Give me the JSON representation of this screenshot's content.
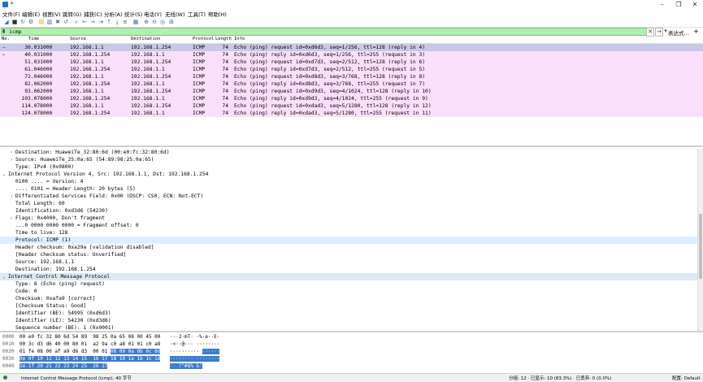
{
  "window": {
    "title": "*"
  },
  "menu": [
    "文件(F)",
    "编辑(E)",
    "视图(V)",
    "跳转(G)",
    "捕获(C)",
    "分析(A)",
    "统计(S)",
    "电话(Y)",
    "无线(W)",
    "工具(T)",
    "帮助(H)"
  ],
  "filter": {
    "value": "icmp",
    "expression_label": "表达式…",
    "plus": "+"
  },
  "columns": [
    "No.",
    "Time",
    "Source",
    "Destination",
    "Protocol",
    "Length",
    "Info"
  ],
  "packets": [
    {
      "no": "3",
      "time": "0.031000",
      "src": "192.168.1.1",
      "dst": "192.168.1.254",
      "proto": "ICMP",
      "len": "74",
      "info": "Echo (ping) request  id=0xd6d3, seq=1/256, ttl=128 (reply in 4)"
    },
    {
      "no": "4",
      "time": "0.031000",
      "src": "192.168.1.254",
      "dst": "192.168.1.1",
      "proto": "ICMP",
      "len": "74",
      "info": "Echo (ping) reply    id=0xd6d3, seq=1/256, ttl=255 (request in 3)"
    },
    {
      "no": "5",
      "time": "1.031000",
      "src": "192.168.1.1",
      "dst": "192.168.1.254",
      "proto": "ICMP",
      "len": "74",
      "info": "Echo (ping) request  id=0xd7d3, seq=2/512, ttl=128 (reply in 6)"
    },
    {
      "no": "6",
      "time": "1.046000",
      "src": "192.168.1.254",
      "dst": "192.168.1.1",
      "proto": "ICMP",
      "len": "74",
      "info": "Echo (ping) reply    id=0xd7d3, seq=2/512, ttl=255 (request in 5)"
    },
    {
      "no": "7",
      "time": "2.046000",
      "src": "192.168.1.1",
      "dst": "192.168.1.254",
      "proto": "ICMP",
      "len": "74",
      "info": "Echo (ping) request  id=0xd8d3, seq=3/768, ttl=128 (reply in 8)"
    },
    {
      "no": "8",
      "time": "2.062000",
      "src": "192.168.1.254",
      "dst": "192.168.1.1",
      "proto": "ICMP",
      "len": "74",
      "info": "Echo (ping) reply    id=0xd8d3, seq=3/768, ttl=255 (request in 7)"
    },
    {
      "no": "9",
      "time": "3.062000",
      "src": "192.168.1.1",
      "dst": "192.168.1.254",
      "proto": "ICMP",
      "len": "74",
      "info": "Echo (ping) request  id=0xd9d3, seq=4/1024, ttl=128 (reply in 10)"
    },
    {
      "no": "10",
      "time": "3.078000",
      "src": "192.168.1.254",
      "dst": "192.168.1.1",
      "proto": "ICMP",
      "len": "74",
      "info": "Echo (ping) reply    id=0xd9d3, seq=4/1024, ttl=255 (request in 9)"
    },
    {
      "no": "11",
      "time": "4.078000",
      "src": "192.168.1.1",
      "dst": "192.168.1.254",
      "proto": "ICMP",
      "len": "74",
      "info": "Echo (ping) request  id=0xdad3, seq=5/1280, ttl=128 (reply in 12)"
    },
    {
      "no": "12",
      "time": "4.078000",
      "src": "192.168.1.254",
      "dst": "192.168.1.1",
      "proto": "ICMP",
      "len": "74",
      "info": "Echo (ping) reply    id=0xdad3, seq=5/1280, ttl=255 (request in 11)"
    }
  ],
  "details": [
    {
      "level": 1,
      "expander": "›",
      "text": "Destination: HuaweiTe_32:80:6d (00:e0:fc:32:80:6d)"
    },
    {
      "level": 1,
      "expander": "›",
      "text": "Source: HuaweiTe_25:0a:65 (54:89:98:25:0a:65)"
    },
    {
      "level": 1,
      "expander": "",
      "text": "Type: IPv4 (0x0800)"
    },
    {
      "level": 0,
      "expander": "⌄",
      "text": "Internet Protocol Version 4, Src: 192.168.1.1, Dst: 192.168.1.254"
    },
    {
      "level": 1,
      "expander": "",
      "text": "0100 .... = Version: 4"
    },
    {
      "level": 1,
      "expander": "",
      "text": ".... 0101 = Header Length: 20 bytes (5)"
    },
    {
      "level": 1,
      "expander": "›",
      "text": "Differentiated Services Field: 0x00 (DSCP: CS0, ECN: Not-ECT)"
    },
    {
      "level": 1,
      "expander": "",
      "text": "Total Length: 60"
    },
    {
      "level": 1,
      "expander": "",
      "text": "Identification: 0xd3d6 (54230)"
    },
    {
      "level": 1,
      "expander": "›",
      "text": "Flags: 0x4000, Don't fragment"
    },
    {
      "level": 1,
      "expander": "",
      "text": "...0 0000 0000 0000 = Fragment offset: 0"
    },
    {
      "level": 1,
      "expander": "",
      "text": "Time to live: 128"
    },
    {
      "level": 1,
      "expander": "",
      "text": "Protocol: ICMP (1)",
      "hl": true
    },
    {
      "level": 1,
      "expander": "",
      "text": "Header checksum: 0xa29a [validation disabled]"
    },
    {
      "level": 1,
      "expander": "",
      "text": "[Header checksum status: Unverified]"
    },
    {
      "level": 1,
      "expander": "",
      "text": "Source: 192.168.1.1"
    },
    {
      "level": 1,
      "expander": "",
      "text": "Destination: 192.168.1.254"
    },
    {
      "level": 0,
      "expander": "⌄",
      "text": "Internet Control Message Protocol",
      "sec": true
    },
    {
      "level": 1,
      "expander": "",
      "text": "Type: 8 (Echo (ping) request)"
    },
    {
      "level": 1,
      "expander": "",
      "text": "Code: 0"
    },
    {
      "level": 1,
      "expander": "",
      "text": "Checksum: 0xafa9 [correct]"
    },
    {
      "level": 1,
      "expander": "",
      "text": "[Checksum Status: Good]"
    },
    {
      "level": 1,
      "expander": "",
      "text": "Identifier (BE): 54995 (0xd6d3)"
    },
    {
      "level": 1,
      "expander": "",
      "text": "Identifier (LE): 54230 (0xd3d6)"
    },
    {
      "level": 1,
      "expander": "",
      "text": "Sequence number (BE): 1 (0x0001)"
    }
  ],
  "hex": [
    {
      "off": "0000",
      "bytes": "00 e0 fc 32 80 6d 54 89  98 25 0a 65 08 00 45 00",
      "sel": "",
      "ascii": "···2·mT· ·%·e··E·",
      "asel": ""
    },
    {
      "off": "0010",
      "bytes": "00 3c d3 d6 40 00 80 01  a2 9a c0 a8 01 01 c0 a8",
      "sel": "",
      "ascii": "·<··@··· ········",
      "asel": ""
    },
    {
      "off": "0020",
      "bytes": "01 fe 08 00 af a9 d6 d3  00 01 ",
      "sel": "08 09 0a 0b 0c 0d",
      "ascii": "·········· ",
      "asel": "······"
    },
    {
      "off": "0030",
      "bytes": "",
      "sel": "0e 0f 10 11 12 13 14 15  16 17 18 19 1a 1b 1c 1d",
      "ascii": "",
      "asel": "········ ········"
    },
    {
      "off": "0040",
      "bytes": "",
      "sel": "1e 1f 20 21 22 23 24 25  26 27",
      "ascii": "",
      "asel": "·· !\"#$% &'"
    }
  ],
  "status": {
    "left": "Internet Control Message Protocol (icmp), 40 字节",
    "packets": "分组: 12 · 已显示: 10 (83.3%) · 已丢弃: 0 (0.0%)",
    "profile": "配置: Default"
  }
}
